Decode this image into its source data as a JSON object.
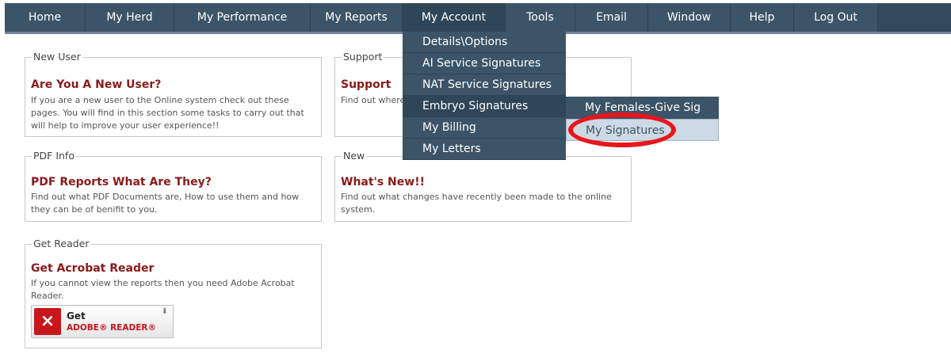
{
  "nav": {
    "items": [
      "Home",
      "My Herd",
      "My Performance",
      "My Reports",
      "My Account",
      "Tools",
      "Email",
      "Window",
      "Help",
      "Log Out"
    ]
  },
  "panels": {
    "new_user": {
      "legend": "New User",
      "title": "Are You A New User?",
      "desc": "If you are a new user to the Online system check out these pages. You will find in this section some tasks to carry out that will help to improve your user experience!!"
    },
    "support": {
      "legend": "Support",
      "title": "Support",
      "desc": "Find out where to get help if you are experiencing difficulty."
    },
    "pdf_info": {
      "legend": "PDF Info",
      "title": "PDF Reports What Are They?",
      "desc": "Find out what PDF Documents are, How to use them and how they can be of benifit to you."
    },
    "new": {
      "legend": "New",
      "title": "What's New!!",
      "desc": "Find out what changes have recently been made to the online system."
    },
    "get_reader": {
      "legend": "Get Reader",
      "title": "Get Acrobat Reader",
      "desc": "If you cannot view the reports then you need Adobe Acrobat Reader.",
      "button_get": "Get",
      "button_reader": "ADOBE® READER®"
    }
  },
  "account_menu": {
    "items": [
      "Details\\Options",
      "AI Service Signatures",
      "NAT Service Signatures",
      "Embryo Signatures",
      "My Billing",
      "My Letters"
    ]
  },
  "embryo_submenu": {
    "items": [
      "My Females-Give Sig",
      "My Signatures"
    ]
  }
}
